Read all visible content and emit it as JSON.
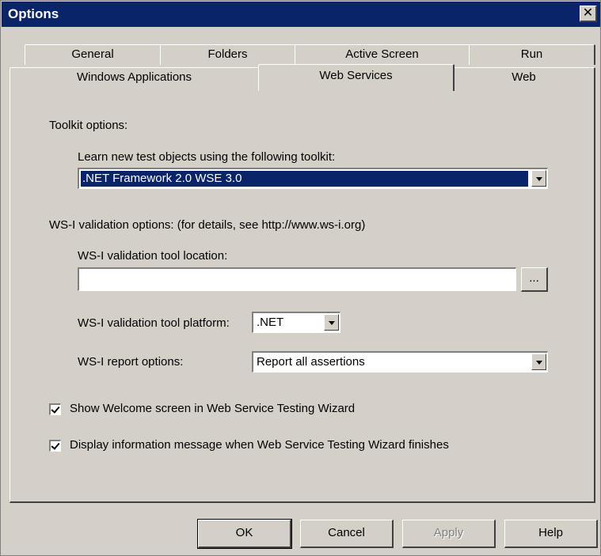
{
  "window": {
    "title": "Options",
    "close_symbol": "✕"
  },
  "tabs_row1": [
    {
      "label": "General"
    },
    {
      "label": "Folders"
    },
    {
      "label": "Active Screen"
    },
    {
      "label": "Run"
    }
  ],
  "tabs_row2": [
    {
      "label": "Windows Applications"
    },
    {
      "label": "Web Services"
    },
    {
      "label": "Web"
    }
  ],
  "active_tab": "Web Services",
  "toolkit": {
    "section_label": "Toolkit options:",
    "learn_label": "Learn new test objects using the following toolkit:",
    "selected": ".NET Framework 2.0 WSE 3.0"
  },
  "wsi": {
    "section_label": "WS-I validation options: (for details, see http://www.ws-i.org)",
    "location_label": "WS-I validation tool location:",
    "location_value": "",
    "browse_label": "...",
    "platform_label": "WS-I validation tool platform:",
    "platform_value": ".NET",
    "report_label": "WS-I report options:",
    "report_value": "Report all assertions"
  },
  "options": {
    "show_welcome": {
      "label": "Show Welcome screen in Web Service Testing Wizard",
      "checked": true
    },
    "display_info": {
      "label": "Display information message when Web Service Testing Wizard finishes",
      "checked": true
    }
  },
  "buttons": {
    "ok": "OK",
    "cancel": "Cancel",
    "apply": "Apply",
    "help": "Help"
  }
}
